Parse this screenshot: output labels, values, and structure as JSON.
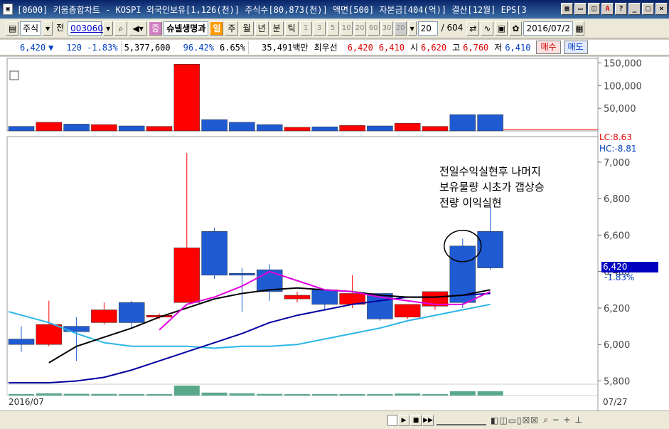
{
  "titlebar": {
    "app_icon": "chart-app-icon",
    "title": "[0600] 키움종합차트 - KOSPI 외국인보유[1,126(천)] 주식수[80,873(천)] 액면[500] 자본금[404(억)] 결산[12월] EPS[3"
  },
  "toolbar": {
    "market_label": "주식",
    "market_extra": "전",
    "code": "003060",
    "search_icon": "search-icon",
    "speaker_icon": "speaker-icon",
    "jeung_label": "증",
    "stock_name": "슈넬생명과",
    "periods": [
      "일",
      "주",
      "월",
      "년",
      "분",
      "틱"
    ],
    "active_period": "일",
    "minute_buttons": [
      "1",
      "3",
      "5",
      "10",
      "20",
      "60",
      "30",
      "20"
    ],
    "count_value": "20",
    "total_count": "/ 604",
    "date_value": "2016/07/2"
  },
  "quote": {
    "price": "6,420",
    "arrow": "▼",
    "change": "120 -1.83%",
    "volume": "5,377,600",
    "vol_ratio": "96.42%",
    "turnover": "6.65%",
    "amount": "35,491백만",
    "priority_label": "최우선",
    "ask": "6,420",
    "bid": "6,410",
    "open_label": "시",
    "open": "6,620",
    "high_label": "고",
    "high": "6,760",
    "low_label": "저",
    "low": "6,410",
    "buy_label": "매수",
    "sell_label": "매도"
  },
  "chart": {
    "lc_label": "LC:8.63",
    "hc_label": "HC:-8.81",
    "last_price_tag": "6,420",
    "last_change": "-1.83%",
    "date_left": "2016/07",
    "date_right": "07/27",
    "annotation_lines": [
      "전일수익실현후 나머지",
      "보유물량 시초가 갭상승",
      "전량 이익실현"
    ]
  },
  "chart_data": {
    "type": "candlestick",
    "price_ticks": [
      "7,000",
      "6,800",
      "6,600",
      "6,400",
      "6,200",
      "6,000",
      "5,800"
    ],
    "price_tick_values": [
      7000,
      6800,
      6600,
      6400,
      6200,
      6000,
      5800
    ],
    "price_range": [
      5720,
      7140
    ],
    "volume_ticks": [
      "150,000",
      "100,000",
      "50,000"
    ],
    "volume_tick_values": [
      150000,
      100000,
      50000
    ],
    "volume_range": [
      0,
      160000
    ],
    "candles": [
      {
        "o": 6030,
        "h": 6100,
        "l": 5960,
        "c": 6000,
        "v": 10000
      },
      {
        "o": 6000,
        "h": 6240,
        "l": 5990,
        "c": 6110,
        "v": 19000
      },
      {
        "o": 6100,
        "h": 6150,
        "l": 5910,
        "c": 6070,
        "v": 15000
      },
      {
        "o": 6120,
        "h": 6230,
        "l": 6110,
        "c": 6190,
        "v": 14000
      },
      {
        "o": 6230,
        "h": 6240,
        "l": 6090,
        "c": 6120,
        "v": 11000
      },
      {
        "o": 6150,
        "h": 6170,
        "l": 6140,
        "c": 6160,
        "v": 10000
      },
      {
        "o": 6230,
        "h": 7050,
        "l": 6230,
        "c": 6530,
        "v": 147000
      },
      {
        "o": 6620,
        "h": 6640,
        "l": 6360,
        "c": 6380,
        "v": 25000
      },
      {
        "o": 6390,
        "h": 6420,
        "l": 6180,
        "c": 6380,
        "v": 19000
      },
      {
        "o": 6410,
        "h": 6440,
        "l": 6240,
        "c": 6290,
        "v": 14000
      },
      {
        "o": 6250,
        "h": 6290,
        "l": 6230,
        "c": 6270,
        "v": 8000
      },
      {
        "o": 6300,
        "h": 6300,
        "l": 6190,
        "c": 6220,
        "v": 9000
      },
      {
        "o": 6220,
        "h": 6380,
        "l": 6200,
        "c": 6280,
        "v": 12000
      },
      {
        "o": 6280,
        "h": 6280,
        "l": 6130,
        "c": 6140,
        "v": 11000
      },
      {
        "o": 6150,
        "h": 6220,
        "l": 6140,
        "c": 6220,
        "v": 17000
      },
      {
        "o": 6210,
        "h": 6290,
        "l": 6190,
        "c": 6290,
        "v": 10000
      },
      {
        "o": 6540,
        "h": 6580,
        "l": 6200,
        "c": 6230,
        "v": 36000
      },
      {
        "o": 6620,
        "h": 6760,
        "l": 6410,
        "c": 6420,
        "v": 36000
      }
    ],
    "ma5": [
      null,
      null,
      null,
      null,
      null,
      6080,
      6220,
      6260,
      6320,
      6400,
      6350,
      6300,
      6290,
      6260,
      6240,
      6220,
      6220,
      6290
    ],
    "ma10": [
      null,
      5900,
      5990,
      6040,
      6090,
      6150,
      6200,
      6250,
      6280,
      6300,
      6310,
      6300,
      6290,
      6270,
      6260,
      6260,
      6270,
      6300
    ],
    "ma20": [
      5790,
      5790,
      5800,
      5820,
      5860,
      5910,
      5960,
      6010,
      6060,
      6120,
      6160,
      6190,
      6220,
      6240,
      6260,
      6260,
      6270,
      6280
    ],
    "ma60": [
      6180,
      6120,
      6060,
      6010,
      5990,
      5990,
      5990,
      5980,
      5990,
      5990,
      6000,
      6030,
      6060,
      6090,
      6130,
      6160,
      6190,
      6220
    ],
    "colors": {
      "up": "#ff0000",
      "down": "#1e5bd2",
      "ma5": "#e000e0",
      "ma10": "#000000",
      "ma20": "#0000a0",
      "ma60": "#2ab6e8"
    }
  },
  "scrollbar": {
    "icons": "◧◫▭▯☒☒"
  }
}
